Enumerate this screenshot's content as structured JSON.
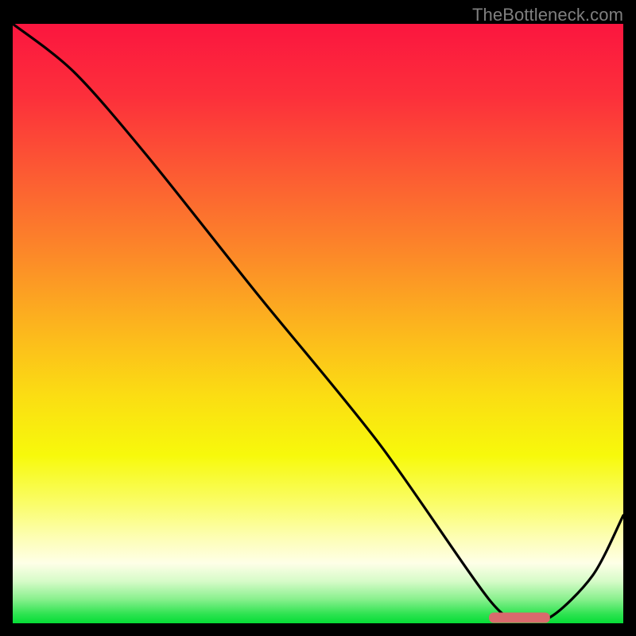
{
  "watermark": "TheBottleneck.com",
  "chart_data": {
    "type": "line",
    "title": "",
    "xlabel": "",
    "ylabel": "",
    "xlim": [
      0,
      100
    ],
    "ylim": [
      0,
      100
    ],
    "x": [
      0,
      10,
      22,
      40,
      60,
      78,
      83,
      88,
      95,
      100
    ],
    "y": [
      100,
      92,
      78,
      55,
      30,
      4,
      1,
      1,
      8,
      18
    ],
    "optimal_marker": {
      "x_start": 78,
      "x_end": 88,
      "y": 1,
      "color": "#d96a6d"
    },
    "background_gradient_stops": [
      {
        "offset": 0.0,
        "color": "#fb163f"
      },
      {
        "offset": 0.12,
        "color": "#fc2f3b"
      },
      {
        "offset": 0.25,
        "color": "#fc5b33"
      },
      {
        "offset": 0.38,
        "color": "#fc8729"
      },
      {
        "offset": 0.5,
        "color": "#fcb31e"
      },
      {
        "offset": 0.62,
        "color": "#fbdd13"
      },
      {
        "offset": 0.72,
        "color": "#f7f90b"
      },
      {
        "offset": 0.8,
        "color": "#fafd68"
      },
      {
        "offset": 0.86,
        "color": "#fdfeb8"
      },
      {
        "offset": 0.9,
        "color": "#feffe7"
      },
      {
        "offset": 0.93,
        "color": "#d6fbc8"
      },
      {
        "offset": 0.96,
        "color": "#88f08d"
      },
      {
        "offset": 0.985,
        "color": "#2de350"
      },
      {
        "offset": 1.0,
        "color": "#05dd36"
      }
    ]
  }
}
